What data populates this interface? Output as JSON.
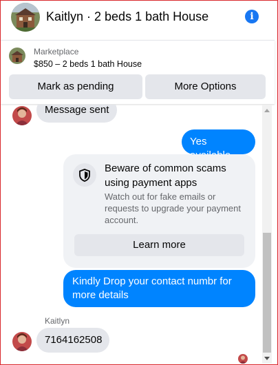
{
  "header": {
    "title": "Kaitlyn · 2 beds 1 bath House",
    "info_icon": "info-icon",
    "accent": "#1877f2"
  },
  "marketplace": {
    "label": "Marketplace",
    "listing": "$850 – 2 beds 1 bath House",
    "mark_pending": "Mark as pending",
    "more_options": "More Options"
  },
  "messages": {
    "partial_text": "Message sent",
    "yes_available": "Yes available",
    "scam_title": "Beware of common scams using payment apps",
    "scam_body": "Watch out for fake emails or requests to upgrade your payment account.",
    "learn_more": "Learn more",
    "contact_request": "Kindly Drop your contact numbr for more details",
    "sender_name": "Kaitlyn",
    "phone": "7164162508"
  },
  "colors": {
    "outgoing": "#0084ff",
    "incoming": "#e4e6eb"
  }
}
